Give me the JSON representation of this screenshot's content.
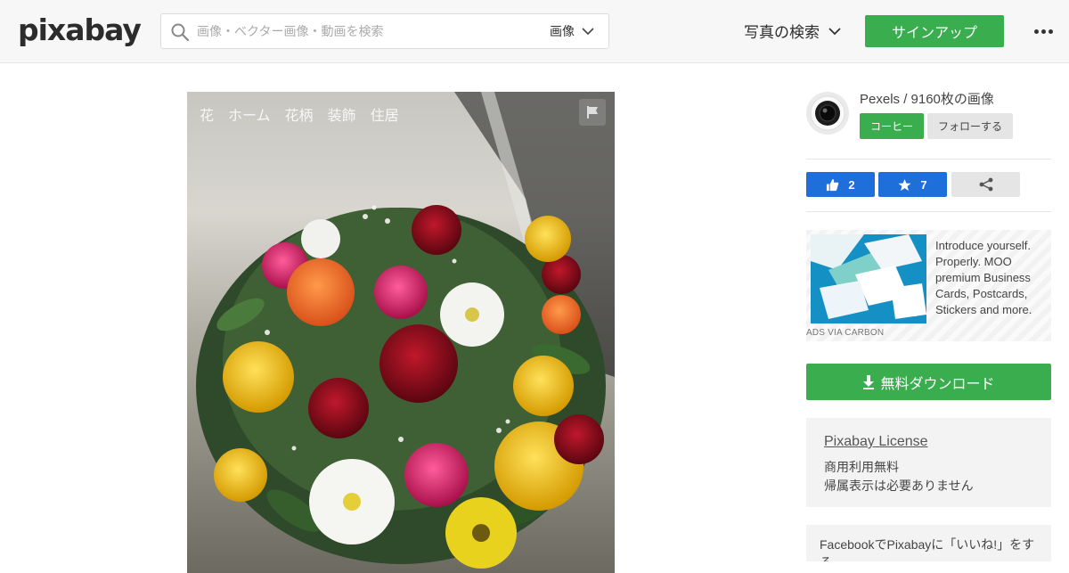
{
  "header": {
    "logo": "pixabay",
    "search": {
      "placeholder": "画像・ベクター画像・動画を検索",
      "type_label": "画像"
    },
    "nav_photo_label": "写真の検索",
    "signup_label": "サインアップ"
  },
  "photo": {
    "tags": [
      "花",
      "ホーム",
      "花柄",
      "装飾",
      "住居"
    ]
  },
  "sidebar": {
    "user_line": "Pexels / 9160枚の画像",
    "coffee_label": "コーヒー",
    "follow_label": "フォローする",
    "like_count": "2",
    "favorite_count": "7",
    "ad": {
      "text": "Introduce yourself. Properly. MOO premium Business Cards, Postcards, Stickers and more.",
      "brand": "MOO",
      "via": "ADS VIA CARBON"
    },
    "download_label": "無料ダウンロード",
    "license": {
      "title": "Pixabay License",
      "line1": "商用利用無料",
      "line2": "帰属表示は必要ありません"
    },
    "facebook_text": "FacebookでPixabayに「いいね!」をする"
  },
  "colors": {
    "green": "#3aad4e",
    "blue": "#1e6fd9",
    "header_bg": "#f7f7f7"
  },
  "icons": [
    "search-icon",
    "chevron-down-icon",
    "more-dots-icon",
    "flag-icon",
    "camera-lens-icon",
    "thumbs-up-icon",
    "star-icon",
    "share-icon",
    "download-icon"
  ]
}
